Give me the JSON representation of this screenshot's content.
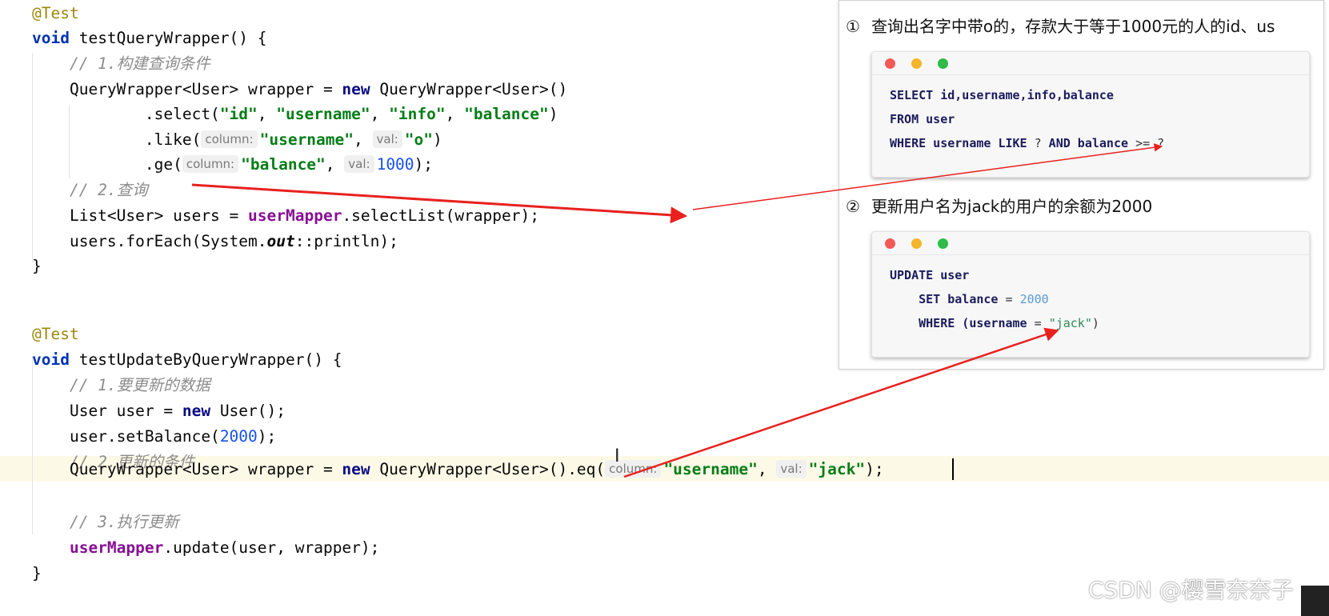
{
  "editor": {
    "lines": [
      {
        "id": "l1",
        "segments": [
          {
            "t": "@Test",
            "c": "ann"
          }
        ]
      },
      {
        "id": "l2",
        "segments": [
          {
            "t": "void",
            "c": "kw"
          },
          {
            "t": " testQueryWrapper() {",
            "c": ""
          }
        ]
      },
      {
        "id": "l3",
        "segments": [
          {
            "t": "    // 1.构建查询条件",
            "c": "cmt"
          }
        ]
      },
      {
        "id": "l4",
        "segments": [
          {
            "t": "    QueryWrapper<User> wrapper = ",
            "c": ""
          },
          {
            "t": "new",
            "c": "kwn"
          },
          {
            "t": " QueryWrapper<User>()",
            "c": ""
          }
        ]
      },
      {
        "id": "l5",
        "segments": [
          {
            "t": "            .select(",
            "c": ""
          },
          {
            "t": "\"id\"",
            "c": "str"
          },
          {
            "t": ", ",
            "c": ""
          },
          {
            "t": "\"username\"",
            "c": "str"
          },
          {
            "t": ", ",
            "c": ""
          },
          {
            "t": "\"info\"",
            "c": "str"
          },
          {
            "t": ", ",
            "c": ""
          },
          {
            "t": "\"balance\"",
            "c": "str"
          },
          {
            "t": ")",
            "c": ""
          }
        ]
      },
      {
        "id": "l6",
        "segments": [
          {
            "t": "            .like(",
            "c": ""
          },
          {
            "t": "column:",
            "c": "hint"
          },
          {
            "t": "\"username\"",
            "c": "str"
          },
          {
            "t": ", ",
            "c": ""
          },
          {
            "t": "val:",
            "c": "hint"
          },
          {
            "t": "\"o\"",
            "c": "str"
          },
          {
            "t": ")",
            "c": ""
          }
        ]
      },
      {
        "id": "l7",
        "segments": [
          {
            "t": "            .ge(",
            "c": ""
          },
          {
            "t": "column:",
            "c": "hint"
          },
          {
            "t": "\"balance\"",
            "c": "str"
          },
          {
            "t": ", ",
            "c": ""
          },
          {
            "t": "val:",
            "c": "hint"
          },
          {
            "t": "1000",
            "c": "num"
          },
          {
            "t": ");",
            "c": ""
          }
        ]
      },
      {
        "id": "l8",
        "segments": [
          {
            "t": "    // 2.查询",
            "c": "cmt"
          }
        ]
      },
      {
        "id": "l9",
        "segments": [
          {
            "t": "    List<User> users = ",
            "c": ""
          },
          {
            "t": "userMapper",
            "c": "fld"
          },
          {
            "t": ".selectList(wrapper);",
            "c": ""
          }
        ]
      },
      {
        "id": "l10",
        "segments": [
          {
            "t": "    users.forEach(System.",
            "c": ""
          },
          {
            "t": "out",
            "c": "stat"
          },
          {
            "t": "::println);",
            "c": ""
          }
        ]
      },
      {
        "id": "l11",
        "segments": [
          {
            "t": "}",
            "c": ""
          }
        ]
      },
      {
        "id": "l12",
        "segments": [
          {
            "t": "@Test",
            "c": "ann"
          }
        ]
      },
      {
        "id": "l13",
        "segments": [
          {
            "t": "void",
            "c": "kw"
          },
          {
            "t": " testUpdateByQueryWrapper() {",
            "c": ""
          }
        ]
      },
      {
        "id": "l14",
        "segments": [
          {
            "t": "    // 1.要更新的数据",
            "c": "cmt"
          }
        ]
      },
      {
        "id": "l15",
        "segments": [
          {
            "t": "    User user = ",
            "c": ""
          },
          {
            "t": "new",
            "c": "kwn"
          },
          {
            "t": " User();",
            "c": ""
          }
        ]
      },
      {
        "id": "l16",
        "segments": [
          {
            "t": "    user.setBalance(",
            "c": ""
          },
          {
            "t": "2000",
            "c": "num"
          },
          {
            "t": ");",
            "c": ""
          }
        ]
      },
      {
        "id": "l17",
        "segments": [
          {
            "t": "    // 2.更新的条件",
            "c": "cmt"
          }
        ]
      },
      {
        "id": "l18",
        "segments": [
          {
            "t": "    QueryWrapper<User> wrapper = ",
            "c": ""
          },
          {
            "t": "new",
            "c": "kwn"
          },
          {
            "t": " QueryWrapper<User>().eq(",
            "c": ""
          },
          {
            "t": "column:",
            "c": "hint"
          },
          {
            "t": "\"username\"",
            "c": "str"
          },
          {
            "t": ", ",
            "c": ""
          },
          {
            "t": "val:",
            "c": "hint"
          },
          {
            "t": "\"jack\"",
            "c": "str"
          },
          {
            "t": ");",
            "c": ""
          }
        ]
      },
      {
        "id": "l19",
        "segments": [
          {
            "t": "    // 3.执行更新",
            "c": "cmt"
          }
        ]
      },
      {
        "id": "l20",
        "segments": [
          {
            "t": "    ",
            "c": ""
          },
          {
            "t": "userMapper",
            "c": "fld"
          },
          {
            "t": ".update(user, wrapper);",
            "c": ""
          }
        ]
      },
      {
        "id": "l21",
        "segments": [
          {
            "t": "}",
            "c": ""
          }
        ]
      }
    ]
  },
  "panel": {
    "q1": {
      "num": "①",
      "text": "查询出名字中带o的，存款大于等于1000元的人的id、us"
    },
    "q1_sql": [
      [
        {
          "t": "SELECT id,username,info,balance",
          "c": ""
        }
      ],
      [
        {
          "t": "FROM user",
          "c": ""
        }
      ],
      [
        {
          "t": "WHERE username LIKE ",
          "c": ""
        },
        {
          "t": "?",
          "c": "op"
        },
        {
          "t": " AND balance ",
          "c": ""
        },
        {
          "t": ">= ?",
          "c": "op"
        }
      ]
    ],
    "q2": {
      "num": "②",
      "text": "更新用户名为jack的用户的余额为2000"
    },
    "q2_sql": [
      [
        {
          "t": "UPDATE user",
          "c": ""
        }
      ],
      [
        {
          "t": "    SET balance ",
          "c": ""
        },
        {
          "t": "= ",
          "c": "op"
        },
        {
          "t": "2000",
          "c": "nm"
        }
      ],
      [
        {
          "t": "    WHERE (username ",
          "c": ""
        },
        {
          "t": "= ",
          "c": "op"
        },
        {
          "t": "\"jack\"",
          "c": "sv"
        },
        {
          "t": ")",
          "c": "op"
        }
      ]
    ]
  },
  "colors": {
    "arrow": "#e8211e",
    "caret_line": "#fcf9e7"
  },
  "watermark": "CSDN @樱雪奈奈子"
}
